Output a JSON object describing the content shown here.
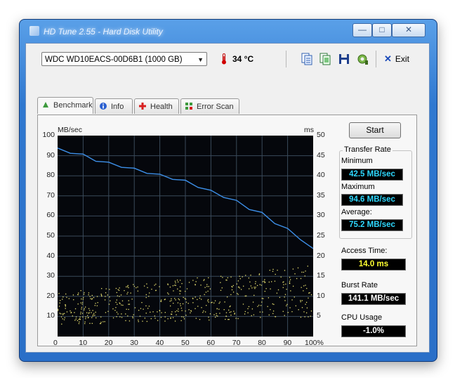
{
  "window": {
    "title": "HD Tune 2.55 - Hard Disk Utility",
    "minimize_label": "—",
    "maximize_label": "□",
    "close_label": "✕"
  },
  "toolbar": {
    "drive": "WDC WD10EACS-00D6B1 (1000 GB)",
    "temperature": "34 °C",
    "buttons": [
      "copy-text-icon",
      "copy-screenshot-icon",
      "save-icon",
      "options-icon"
    ],
    "exit_label": "Exit"
  },
  "tabs": [
    {
      "label": "Benchmark",
      "icon": "benchmark-icon",
      "active": true
    },
    {
      "label": "Info",
      "icon": "info-icon",
      "active": false
    },
    {
      "label": "Health",
      "icon": "health-icon",
      "active": false
    },
    {
      "label": "Error Scan",
      "icon": "error-scan-icon",
      "active": false
    }
  ],
  "benchmark": {
    "start_label": "Start",
    "transfer_rate": {
      "title": "Transfer Rate",
      "minimum_label": "Minimum",
      "minimum": "42.5 MB/sec",
      "maximum_label": "Maximum",
      "maximum": "94.6 MB/sec",
      "average_label": "Average:",
      "average": "75.2 MB/sec"
    },
    "access_time_label": "Access Time:",
    "access_time": "14.0 ms",
    "burst_rate_label": "Burst Rate",
    "burst_rate": "141.1 MB/sec",
    "cpu_usage_label": "CPU Usage",
    "cpu_usage": "-1.0%"
  },
  "chart_data": {
    "type": "line",
    "ylabel_left": "MB/sec",
    "ylabel_right": "ms",
    "left_ticks": [
      10,
      20,
      30,
      40,
      50,
      60,
      70,
      80,
      90,
      100
    ],
    "right_ticks": [
      5,
      10,
      15,
      20,
      25,
      30,
      35,
      40,
      45,
      50
    ],
    "x_ticks": [
      "0",
      "10",
      "20",
      "30",
      "40",
      "50",
      "60",
      "70",
      "80",
      "90",
      "100%"
    ],
    "ylim": [
      0,
      100
    ],
    "y2lim": [
      0,
      50
    ],
    "xlim": [
      0,
      100
    ],
    "grid": true,
    "series": [
      {
        "name": "Transfer Rate",
        "axis": "left",
        "color": "#3d8fe8",
        "x": [
          0,
          5,
          10,
          15,
          20,
          25,
          30,
          35,
          40,
          45,
          50,
          55,
          60,
          65,
          70,
          75,
          80,
          85,
          90,
          95,
          100
        ],
        "values": [
          93,
          92,
          90,
          88,
          86,
          85,
          83,
          82,
          80,
          79,
          77,
          75,
          72,
          70,
          67,
          64,
          61,
          57,
          53,
          49,
          43
        ]
      },
      {
        "name": "Access Time",
        "axis": "right",
        "type": "scatter",
        "color": "#e8e070",
        "range_ms": [
          3,
          17
        ],
        "trend": "rising lower and upper bound across the disk"
      }
    ]
  }
}
